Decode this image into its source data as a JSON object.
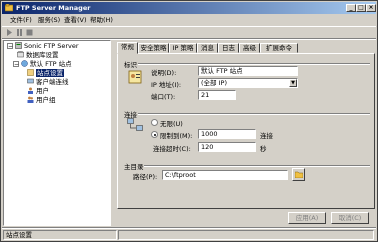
{
  "window": {
    "title": "FTP Server Manager"
  },
  "menu": {
    "items": [
      "文件(F)",
      "服务(S)",
      "查看(V)",
      "帮助(H)"
    ]
  },
  "tree": {
    "root": "Sonic FTP Server",
    "items": [
      "数据库设置",
      "默认 FTP 站点",
      "站点设置",
      "客户端连线",
      "用户",
      "用户组"
    ]
  },
  "tabs": [
    "常规",
    "安全策略",
    "IP 策略",
    "消息",
    "日志",
    "高级",
    "扩展命令"
  ],
  "general": {
    "identity_group": "标识",
    "description_label": "说明(D):",
    "description_value": "默认 FTP 站点",
    "ip_label": "IP 地址(I):",
    "ip_value": "(全部 IP)",
    "port_label": "端口(T):",
    "port_value": "21",
    "connections_group": "连接",
    "unlimited_label": "无限(U)",
    "limited_label": "限制到(M):",
    "limited_value": "1000",
    "limited_unit": "连接",
    "timeout_label": "连接超时(C):",
    "timeout_value": "120",
    "timeout_unit": "秒",
    "homedir_group": "主目录",
    "path_label": "路径(P):",
    "path_value": "C:\\ftproot"
  },
  "buttons": {
    "apply": "应用(A)",
    "cancel": "取消(C)"
  },
  "status": {
    "text": "站点设置"
  }
}
